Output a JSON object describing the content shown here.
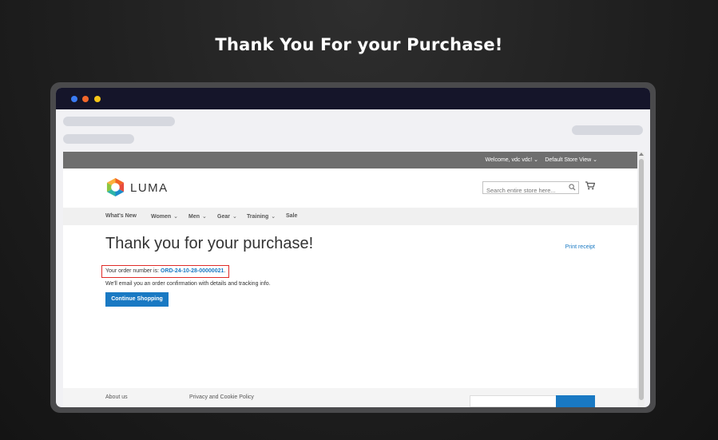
{
  "headline": "Thank You For your Purchase!",
  "store": {
    "welcome": "Welcome, vdc vdc!",
    "store_view": "Default Store View",
    "brand": "LUMA",
    "search_placeholder": "Search entire store here...",
    "nav": [
      "What's New",
      "Women",
      "Men",
      "Gear",
      "Training",
      "Sale"
    ]
  },
  "page": {
    "title": "Thank you for your purchase!",
    "print_receipt": "Print receipt",
    "order_prefix": "Your order number is: ",
    "order_number": "ORD-24-10-28-00000021",
    "order_suffix": ".",
    "email_note": "We'll email you an order confirmation with details and tracking info.",
    "continue_button": "Continue Shopping"
  },
  "footer": {
    "links": [
      "About us",
      "Privacy and Cookie Policy"
    ]
  },
  "colors": {
    "accent": "#1979c3",
    "highlight": "#e02b27",
    "topbar": "#6e6e6e"
  }
}
